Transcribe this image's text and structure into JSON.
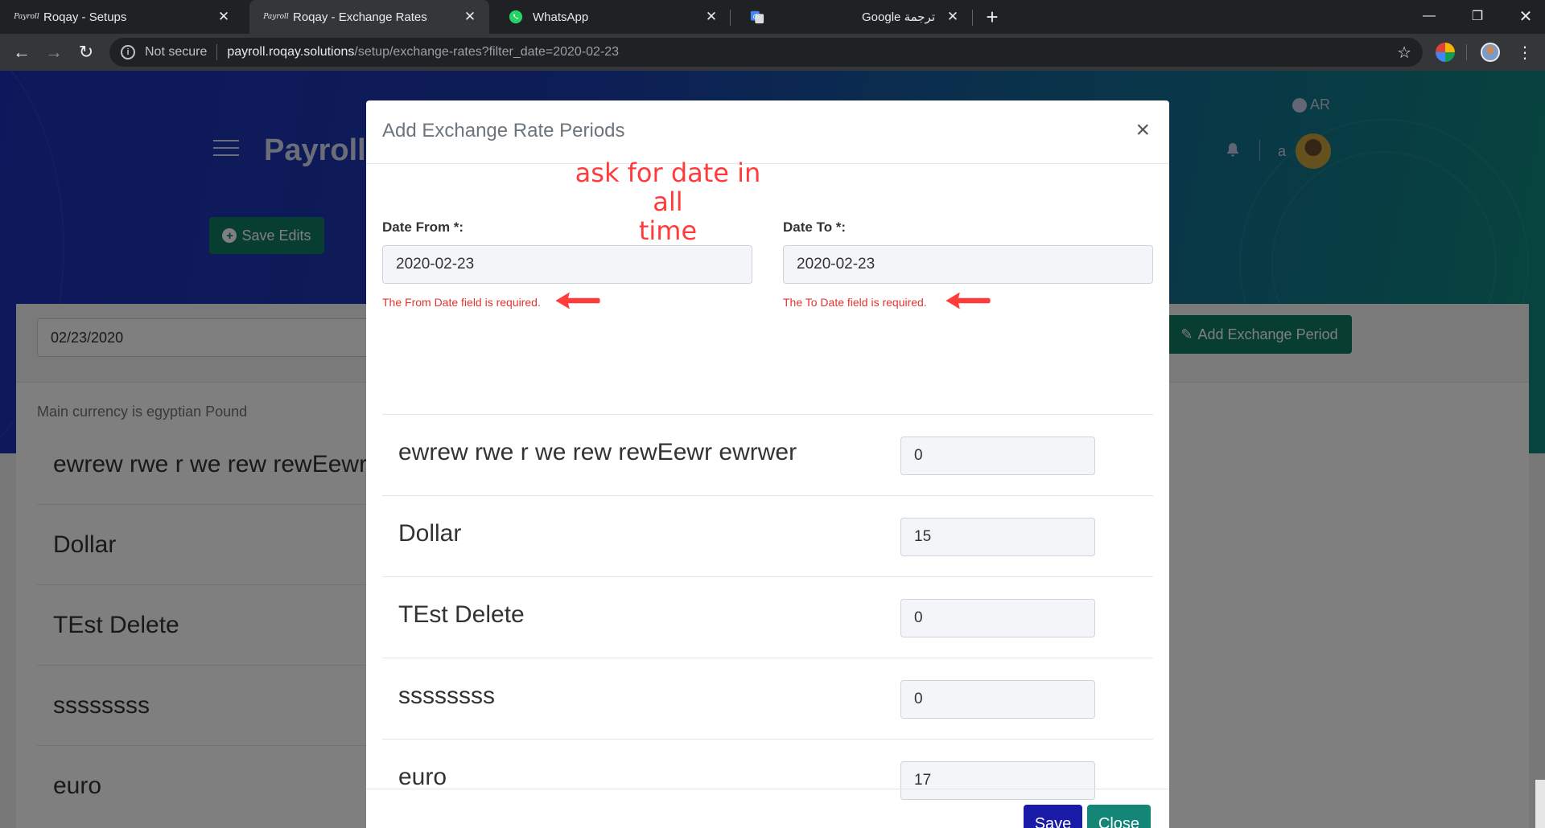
{
  "browser": {
    "tabs": [
      {
        "title": "Roqay - Setups",
        "favicon": "Payroll",
        "active": false
      },
      {
        "title": "Roqay - Exchange Rates",
        "favicon": "Payroll",
        "active": true
      },
      {
        "title": "WhatsApp",
        "favicon": "whatsapp-icon",
        "active": false
      },
      {
        "title": "Google ترجمة",
        "favicon": "google-translate-icon",
        "active": false
      }
    ],
    "security_label": "Not secure",
    "url_host": "payroll.roqay.solutions",
    "url_path": "/setup/exchange-rates?filter_date=2020-02-23"
  },
  "header": {
    "brand": "Payroll",
    "save_edits_label": "Save Edits",
    "lang_label": "AR",
    "user_initial": "a"
  },
  "page": {
    "filter_date": "02/23/2020",
    "add_period_label": "Add Exchange Period",
    "main_currency_note": "Main currency is egyptian Pound",
    "currencies": [
      "ewrew rwe r we rew rewEewr ewrwer",
      "Dollar",
      "TEst Delete",
      "ssssssss",
      "euro"
    ]
  },
  "modal": {
    "title": "Add Exchange Rate Periods",
    "date_from_label": "Date From *:",
    "date_from_value": "2020-02-23",
    "date_from_error": "The From Date field is required.",
    "date_to_label": "Date To *:",
    "date_to_value": "2020-02-23",
    "date_to_error": "The To Date field is required.",
    "rows": [
      {
        "name": "ewrew rwe r we rew rewEewr ewrwer",
        "value": "0"
      },
      {
        "name": "Dollar",
        "value": "15"
      },
      {
        "name": "TEst Delete",
        "value": "0"
      },
      {
        "name": "ssssssss",
        "value": "0"
      },
      {
        "name": "euro",
        "value": "17"
      }
    ],
    "save_label": "Save",
    "close_label": "Close"
  },
  "annotation": {
    "line1": "ask for date in all",
    "line2": "time",
    "color": "#ff3b3b"
  },
  "colors": {
    "primary_green": "#117a65",
    "save_blue": "#1a1aa8",
    "error_red": "#e3342f"
  }
}
